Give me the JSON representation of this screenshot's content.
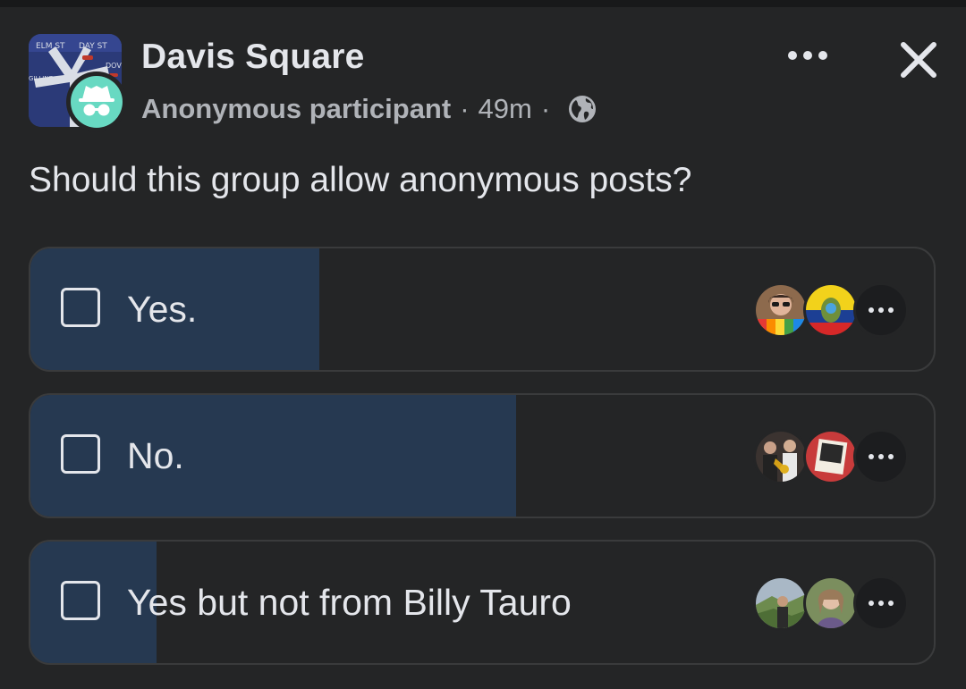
{
  "post": {
    "group_name": "Davis Square",
    "author": "Anonymous participant",
    "separator": "·",
    "time": "49m",
    "privacy_icon": "globe-icon",
    "more_icon": "more-horizontal-icon",
    "close_icon": "close-icon",
    "group_avatar_street_signs": [
      "ELM ST",
      "DAY ST",
      "DOVE ST",
      "GILLINE AVE"
    ],
    "question": "Should this group allow anonymous posts?"
  },
  "poll": {
    "options": [
      {
        "label": "Yes.",
        "fill_fraction": 0.32
      },
      {
        "label": "No.",
        "fill_fraction": 0.538
      },
      {
        "label": "Yes but not from Billy Tauro",
        "fill_fraction": 0.14
      }
    ]
  },
  "colors": {
    "background": "#242526",
    "poll_fill": "#263951",
    "text_primary": "#e4e6eb",
    "text_secondary": "#b0b3b8",
    "anonymous_badge": "#68d9c2"
  }
}
